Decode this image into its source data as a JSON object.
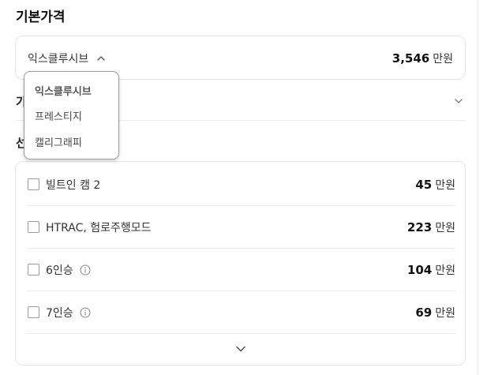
{
  "basic_price": {
    "title": "기본가격",
    "selected_trim": "익스클루시브",
    "price_value": "3,546",
    "price_unit": "만원"
  },
  "dropdown": {
    "items": [
      {
        "label": "익스클루시브",
        "selected": true
      },
      {
        "label": "프레스티지",
        "selected": false
      },
      {
        "label": "캘리그래피",
        "selected": false
      }
    ]
  },
  "partially_hidden": {
    "row_initial": "가",
    "options_initial": "선"
  },
  "options": {
    "items": [
      {
        "label": "빌트인 캠 2",
        "price": "45",
        "unit": "만원",
        "info": false,
        "checked": false
      },
      {
        "label": "HTRAC, 험로주행모드",
        "price": "223",
        "unit": "만원",
        "info": false,
        "checked": false
      },
      {
        "label": "6인승",
        "price": "104",
        "unit": "만원",
        "info": true,
        "checked": false
      },
      {
        "label": "7인승",
        "price": "69",
        "unit": "만원",
        "info": true,
        "checked": false
      }
    ]
  },
  "icons": {
    "trim_chevron": "chevron-up-icon",
    "row_chevron": "chevron-down-icon",
    "expand": "chevron-down-icon",
    "info": "info-circle-icon"
  },
  "colors": {
    "text": "#222222",
    "muted": "#444444",
    "border": "#e6e6e6",
    "dropdown_border": "#9b9b9b"
  }
}
